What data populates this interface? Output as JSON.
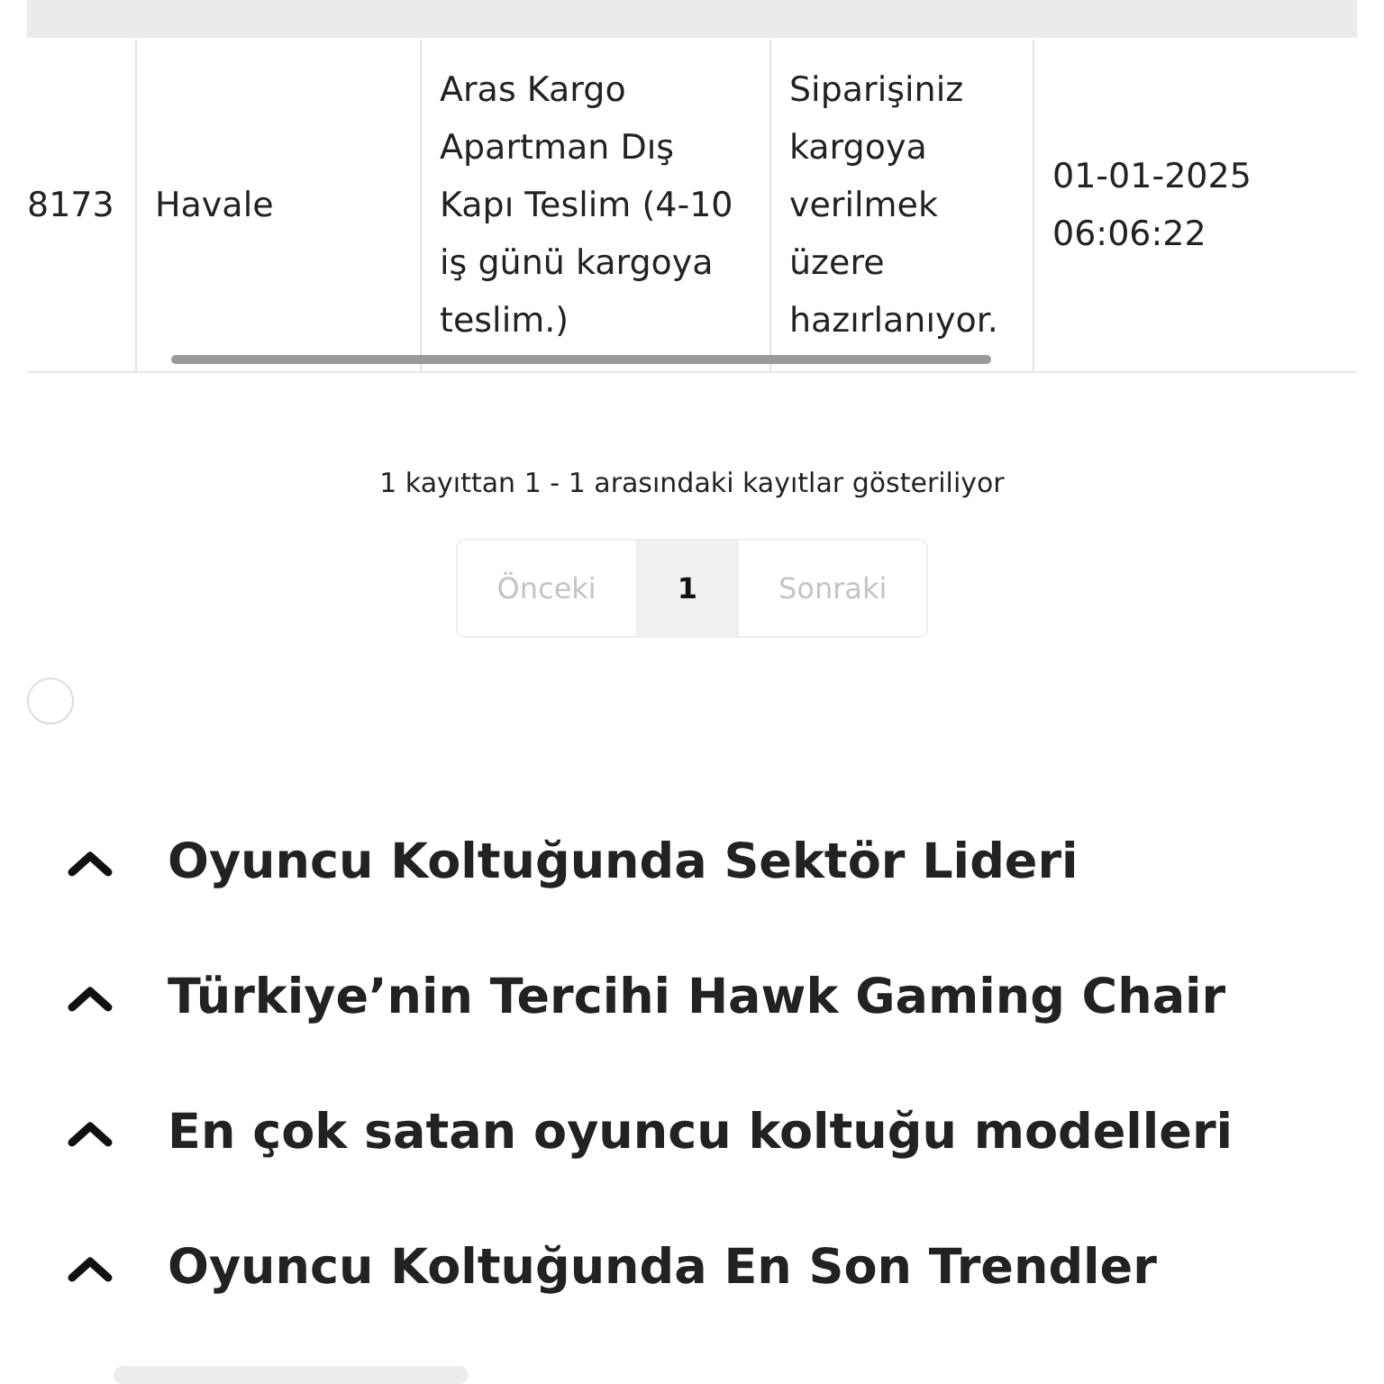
{
  "table": {
    "rows": [
      {
        "cells": [
          "8173",
          "Havale",
          "Aras Kargo Apartman Dış Kapı Teslim (4-10 iş günü kargoya teslim.)",
          "Siparişiniz kargoya verilmek üzere hazırlanıyor.",
          "01-01-2025 06:06:22"
        ]
      }
    ]
  },
  "info": "1 kayıttan 1 - 1 arasındaki kayıtlar gösteriliyor",
  "pagination": [
    {
      "label": "Önceki",
      "selected": false,
      "disabled": true
    },
    {
      "label": "1",
      "selected": true,
      "disabled": false
    },
    {
      "label": "Sonraki",
      "selected": false,
      "disabled": true
    }
  ],
  "radio": {
    "checked": false
  },
  "accordion": [
    {
      "title": "Oyuncu Koltuğunda Sektör Lideri",
      "expanded": true
    },
    {
      "title": "Türkiye’nin Tercihi Hawk Gaming Chair",
      "expanded": true
    },
    {
      "title": "En çok satan oyuncu koltuğu modelleri",
      "expanded": true
    },
    {
      "title": "Oyuncu Koltuğunda En Son Trendler",
      "expanded": true
    }
  ]
}
